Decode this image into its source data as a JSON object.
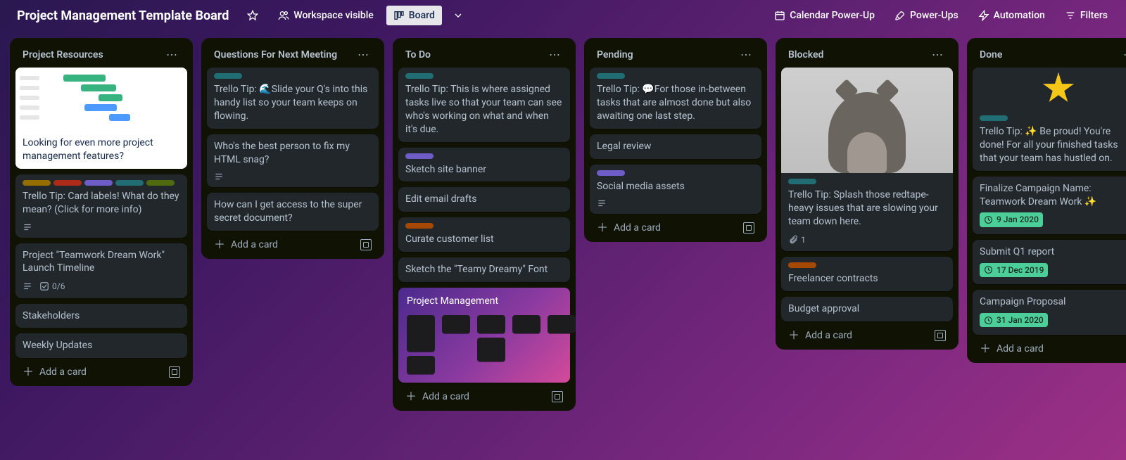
{
  "header": {
    "title": "Project Management Template Board",
    "workspace_visible": "Workspace visible",
    "board_btn": "Board",
    "calendar": "Calendar Power-Up",
    "powerups": "Power-Ups",
    "automation": "Automation",
    "filters": "Filters"
  },
  "add_card_label": "Add a card",
  "lists": [
    {
      "title": "Project Resources",
      "cards": [
        {
          "type": "gantt_cover",
          "text": "Looking for even more project management features?"
        },
        {
          "labels": [
            "yellow",
            "red",
            "purple",
            "teal",
            "green"
          ],
          "text": "Trello Tip: Card labels! What do they mean? (Click for more info)",
          "desc_icon": true
        },
        {
          "text": "Project \"Teamwork Dream Work\" Launch Timeline",
          "desc_icon": true,
          "checklist": "0/6"
        },
        {
          "text": "Stakeholders"
        },
        {
          "text": "Weekly Updates"
        }
      ]
    },
    {
      "title": "Questions For Next Meeting",
      "cards": [
        {
          "labels": [
            "teal"
          ],
          "text": "Trello Tip: 🌊Slide your Q's into this handy list so your team keeps on flowing."
        },
        {
          "text": "Who's the best person to fix my HTML snag?",
          "desc_icon": true
        },
        {
          "text": "How can I get access to the super secret document?"
        }
      ]
    },
    {
      "title": "To Do",
      "cards": [
        {
          "labels": [
            "teal"
          ],
          "text": "Trello Tip: This is where assigned tasks live so that your team can see who's working on what and when it's due."
        },
        {
          "labels": [
            "purple"
          ],
          "text": "Sketch site banner"
        },
        {
          "text": "Edit email drafts"
        },
        {
          "labels": [
            "orange"
          ],
          "text": "Curate customer list"
        },
        {
          "text": "Sketch the \"Teamy Dreamy\" Font"
        },
        {
          "type": "pm_preview",
          "text": "Project Management"
        }
      ]
    },
    {
      "title": "Pending",
      "cards": [
        {
          "labels": [
            "teal"
          ],
          "text": "Trello Tip: 💬For those in-between tasks that are almost done but also awaiting one last step."
        },
        {
          "text": "Legal review"
        },
        {
          "labels": [
            "purple"
          ],
          "text": "Social media assets",
          "desc_icon": true
        }
      ]
    },
    {
      "title": "Blocked",
      "cards": [
        {
          "type": "cat_cover",
          "labels": [
            "teal"
          ],
          "text": "Trello Tip: Splash those redtape-heavy issues that are slowing your team down here.",
          "attachments": "1"
        },
        {
          "labels": [
            "orange"
          ],
          "text": "Freelancer contracts"
        },
        {
          "text": "Budget approval"
        }
      ]
    },
    {
      "title": "Done",
      "cards": [
        {
          "type": "star_cover",
          "labels": [
            "teal"
          ],
          "text": "Trello Tip: ✨ Be proud! You're done! For all your finished tasks that your team has hustled on."
        },
        {
          "text": "Finalize Campaign Name: Teamwork Dream Work ✨",
          "due": "9 Jan 2020"
        },
        {
          "text": "Submit Q1 report",
          "due": "17 Dec 2019"
        },
        {
          "text": "Campaign Proposal",
          "due": "31 Jan 2020"
        }
      ]
    }
  ]
}
